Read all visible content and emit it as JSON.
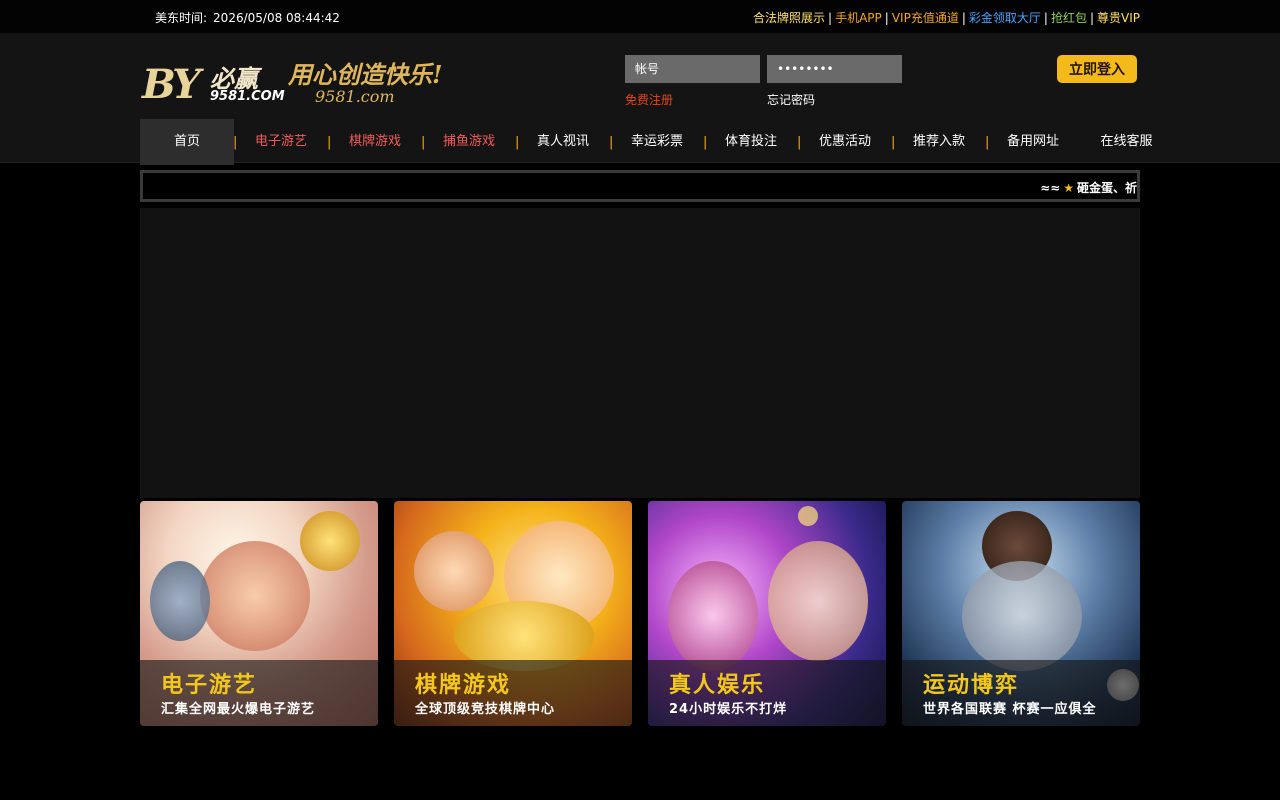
{
  "topbar": {
    "time_label": "美东时间:",
    "time_value": "2026/05/08 08:44:42",
    "links": [
      {
        "label": "合法牌照展示",
        "color": "#ffe066"
      },
      {
        "label": "手机APP",
        "color": "#f4a81a"
      },
      {
        "label": "VIP充值通道",
        "color": "#f4a81a"
      },
      {
        "label": "彩金领取大厅",
        "color": "#4aa3ff"
      },
      {
        "label": "抢红包",
        "color": "#8fd14f"
      },
      {
        "label": "尊贵VIP",
        "color": "#ffe066"
      }
    ]
  },
  "logo": {
    "brand_mark": "BY",
    "brand_cn": "必赢",
    "brand_num": "9581.COM",
    "slogan": "用心创造快乐!",
    "slogan_url": "9581.com"
  },
  "login": {
    "username_placeholder": "帐号",
    "password_value": "••••••••",
    "register_label": "免费注册",
    "forgot_label": "忘记密码",
    "login_button": "立即登入"
  },
  "nav": {
    "items": [
      {
        "label": "首页"
      },
      {
        "label": "电子游艺"
      },
      {
        "label": "棋牌游戏"
      },
      {
        "label": "捕鱼游戏"
      },
      {
        "label": "真人视讯"
      },
      {
        "label": "幸运彩票"
      },
      {
        "label": "体育投注"
      },
      {
        "label": "优惠活动"
      },
      {
        "label": "推荐入款"
      },
      {
        "label": "备用网址"
      },
      {
        "label": "在线客服"
      }
    ],
    "divider": "|"
  },
  "marquee": {
    "lead": "≈≈",
    "text": "砸金蛋、祈"
  },
  "cards": [
    {
      "title": "电子游艺",
      "subtitle": "汇集全网最火爆电子游艺"
    },
    {
      "title": "棋牌游戏",
      "subtitle": "全球顶级竞技棋牌中心"
    },
    {
      "title": "真人娱乐",
      "subtitle": "24小时娱乐不打烊"
    },
    {
      "title": "运动博弈",
      "subtitle": "世界各国联赛 杯赛一应俱全"
    }
  ],
  "colors": {
    "accent": "#f4b91a",
    "nav_hot": "#f25a5a",
    "register": "#e9441b"
  }
}
